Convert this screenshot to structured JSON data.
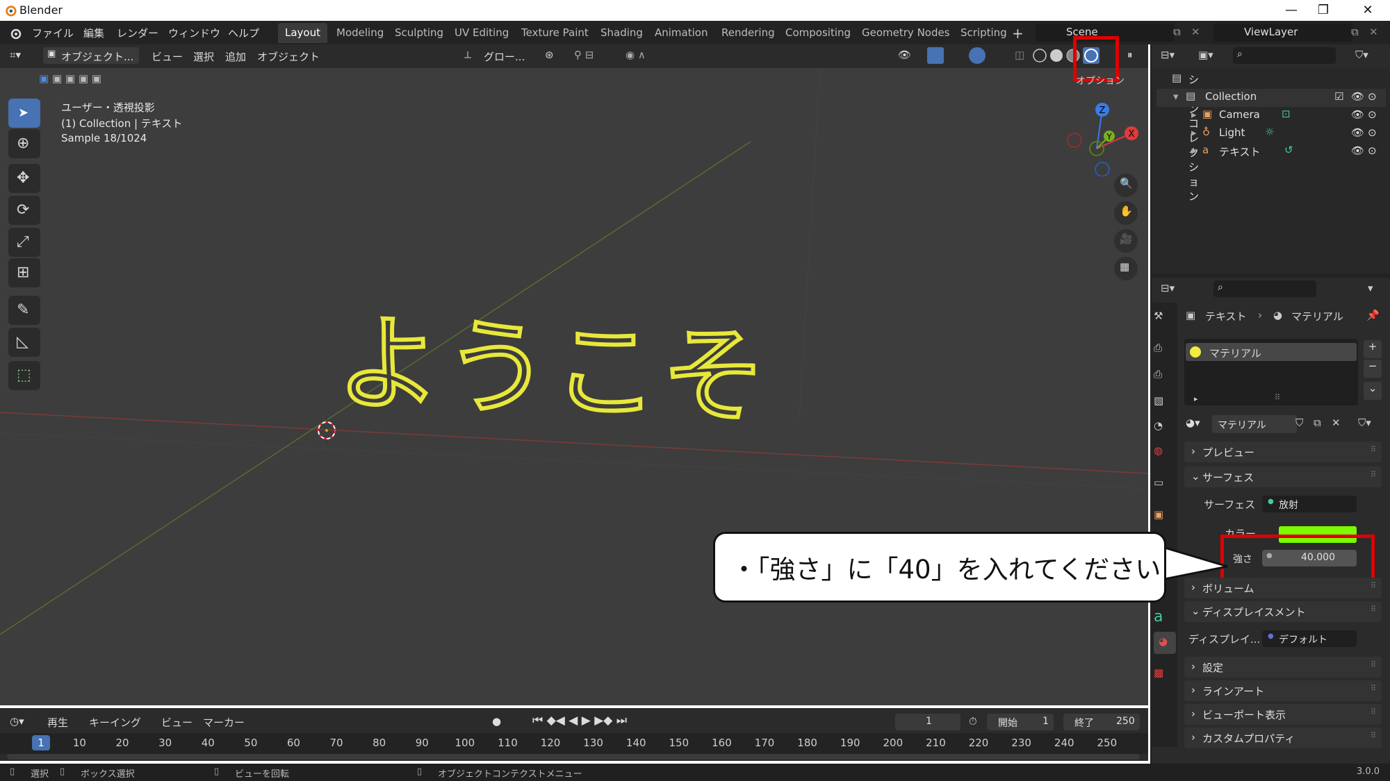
{
  "titlebar": {
    "app_title": "Blender"
  },
  "menu": {
    "items": [
      "ファイル",
      "編集",
      "レンダー",
      "ウィンドウ",
      "ヘルプ"
    ]
  },
  "workspaces": {
    "tabs": [
      "Layout",
      "Modeling",
      "Sculpting",
      "UV Editing",
      "Texture Paint",
      "Shading",
      "Animation",
      "Rendering",
      "Compositing",
      "Geometry Nodes",
      "Scripting"
    ],
    "active": "Layout",
    "add_label": "+"
  },
  "scene": {
    "name": "Scene",
    "view_layer": "ViewLayer"
  },
  "viewport": {
    "mode": "オブジェクト...",
    "menus": [
      "ビュー",
      "選択",
      "追加",
      "オブジェクト"
    ],
    "transform_orientation": "グロー...",
    "options_label": "オプション",
    "overlay_line1": "ユーザー・透視投影",
    "overlay_line2": "(1) Collection | テキスト",
    "overlay_line3": "Sample 18/1024",
    "text_object": "ようこそ",
    "gizmo": {
      "z": "Z",
      "y": "Y",
      "x": "X"
    }
  },
  "outliner": {
    "header": "シーンコレクション",
    "collection": "Collection",
    "items": [
      "Camera",
      "Light",
      "テキスト"
    ]
  },
  "properties": {
    "breadcrumb_object": "テキスト",
    "breadcrumb_material": "マテリアル",
    "slot_name": "マテリアル",
    "material_name": "マテリアル",
    "panels": {
      "preview": "プレビュー",
      "surface": "サーフェス",
      "volume": "ボリューム",
      "displacement": "ディスプレイスメント",
      "settings": "設定",
      "lineart": "ラインアート",
      "viewport_display": "ビューポート表示",
      "custom_props": "カスタムプロパティ"
    },
    "surface_label": "サーフェス",
    "surface_value": "放射",
    "color_label": "カラー",
    "color_value": "#7cfc00",
    "strength_label": "強さ",
    "strength_value": "40.000",
    "displacement_label": "ディスプレイ...",
    "displacement_value": "デフォルト"
  },
  "timeline": {
    "menus": [
      "再生",
      "キーイング",
      "ビュー",
      "マーカー"
    ],
    "current_frame": "1",
    "start_label": "開始",
    "start_value": "1",
    "end_label": "終了",
    "end_value": "250",
    "ticks": [
      "1",
      "10",
      "20",
      "30",
      "40",
      "50",
      "60",
      "70",
      "80",
      "90",
      "100",
      "110",
      "120",
      "130",
      "140",
      "150",
      "160",
      "170",
      "180",
      "190",
      "200",
      "210",
      "220",
      "230",
      "240",
      "250"
    ]
  },
  "statusbar": {
    "select": "選択",
    "box_select": "ボックス選択",
    "rotate_view": "ビューを回転",
    "context_menu": "オブジェクトコンテクストメニュー",
    "version": "3.0.0"
  },
  "callout": {
    "text": "・「強さ」に「40」を入れてください"
  },
  "colors": {
    "accent": "#4772b3",
    "highlight": "#e00000",
    "text_object": "#e8e83a"
  }
}
